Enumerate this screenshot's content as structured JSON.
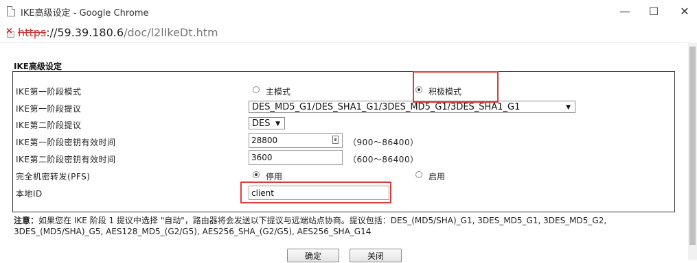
{
  "window": {
    "title": "IKE高级设定 - Google Chrome",
    "minimize": "—",
    "maximize": "☐",
    "close": "✕"
  },
  "address": {
    "scheme": "https",
    "host": "://59.39.180.6",
    "path": "/doc/l2lIkeDt.htm"
  },
  "form": {
    "section_title": "IKE高级设定",
    "rows": {
      "phase1_mode": {
        "label": "IKE第一阶段模式",
        "options": [
          "主模式",
          "积极模式"
        ],
        "selected": "积极模式"
      },
      "phase1_proposal": {
        "label": "IKE第一阶段提议",
        "value": "DES_MD5_G1/DES_SHA1_G1/3DES_MD5_G1/3DES_SHA1_G1"
      },
      "phase2_proposal": {
        "label": "IKE第二阶段提议",
        "value": "DES"
      },
      "phase1_lifetime": {
        "label": "IKE第一阶段密钥有效时间",
        "value": "28800",
        "range": "（900～86400）"
      },
      "phase2_lifetime": {
        "label": "IKE第二阶段密钥有效时间",
        "value": "3600",
        "range": "（600～86400）"
      },
      "pfs": {
        "label": "完全机密转发(PFS)",
        "options": [
          "停用",
          "启用"
        ],
        "selected": "停用"
      },
      "local_id": {
        "label": "本地ID",
        "value": "client"
      }
    }
  },
  "note": {
    "prefix": "注意：",
    "text": "如果您在 IKE 阶段 1 提议中选择 \"自动\"，路由器将会发送以下提议与远端站点协商。提议包括：DES_(MD5/SHA)_G1, 3DES_MD5_G1, 3DES_MD5_G2, 3DES_(MD5/SHA)_G5, AES128_MD5_(G2/G5), AES256_SHA_(G2/G5), AES256_SHA_G14"
  },
  "buttons": {
    "ok": "确定",
    "close": "关闭"
  },
  "colors": {
    "highlight": "#e03b3b"
  }
}
